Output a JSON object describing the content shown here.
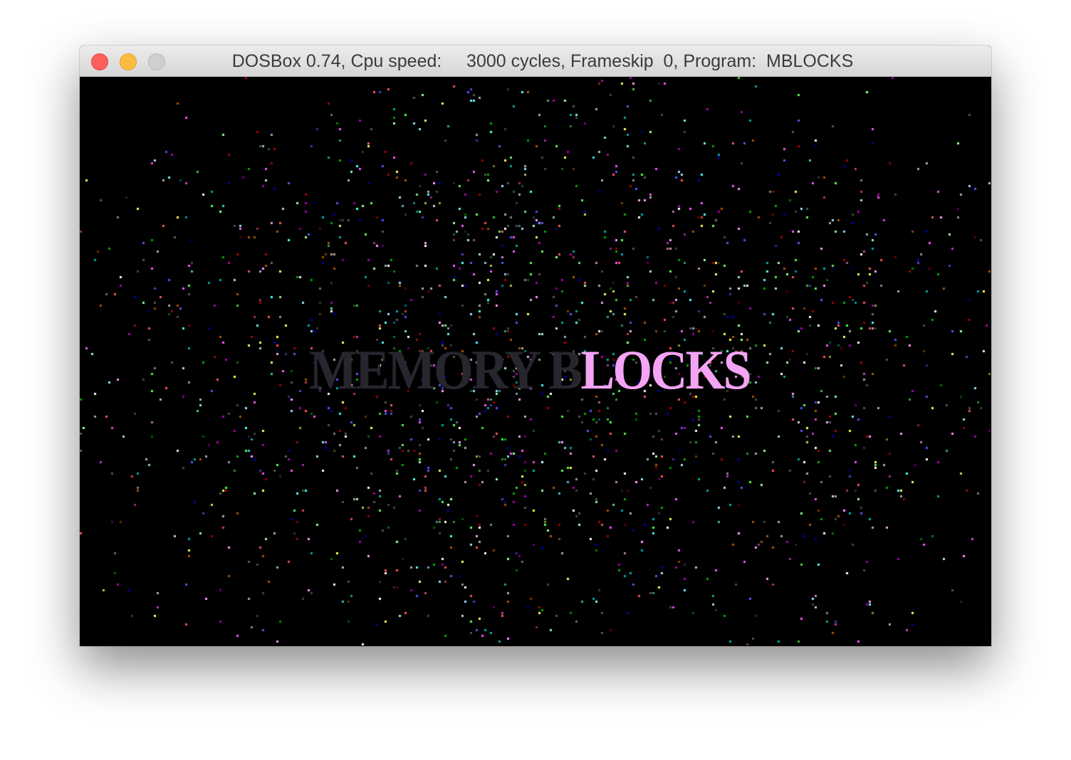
{
  "window": {
    "title": "DOSBox 0.74, Cpu speed:     3000 cycles, Frameskip  0, Program:  MBLOCKS",
    "controls": {
      "close": "close-icon",
      "minimize": "minimize-icon",
      "zoom": "zoom-icon"
    }
  },
  "screen": {
    "logo_dim": "MEMORY B",
    "logo_bright": "LOCKS",
    "colors": {
      "background": "#000000",
      "logo_dim": "#27262f",
      "logo_bright": "#f4a4f4",
      "pixels": [
        "#ff5555",
        "#55ff55",
        "#5555ff",
        "#ffff55",
        "#ff55ff",
        "#55ffff",
        "#ffffff",
        "#aaaaaa",
        "#aa5500",
        "#00aa00",
        "#aa00aa",
        "#00aaaa",
        "#555555",
        "#aa0000",
        "#0000aa",
        "#ff9fff",
        "#9fff9f",
        "#9fdfff",
        "#335533"
      ]
    }
  }
}
